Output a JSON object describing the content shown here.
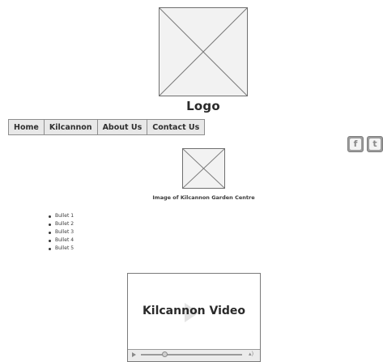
{
  "logo": {
    "text": "Logo"
  },
  "nav": {
    "items": [
      {
        "label": "Home"
      },
      {
        "label": "Kilcannon"
      },
      {
        "label": "About Us"
      },
      {
        "label": "Contact Us"
      }
    ]
  },
  "social": {
    "facebook_icon": "facebook-icon",
    "twitter_icon": "twitter-icon"
  },
  "image": {
    "caption": "Image of Kilcannon Garden Centre"
  },
  "bullets": {
    "items": [
      {
        "text": "Bullet 1"
      },
      {
        "text": "Bullet 2"
      },
      {
        "text": "Bullet 3"
      },
      {
        "text": "Bullet 4"
      },
      {
        "text": "Bullet 5"
      }
    ]
  },
  "video": {
    "title": "Kilcannon Video",
    "play_icon": "play-icon",
    "volume_icon": "volume-icon"
  }
}
